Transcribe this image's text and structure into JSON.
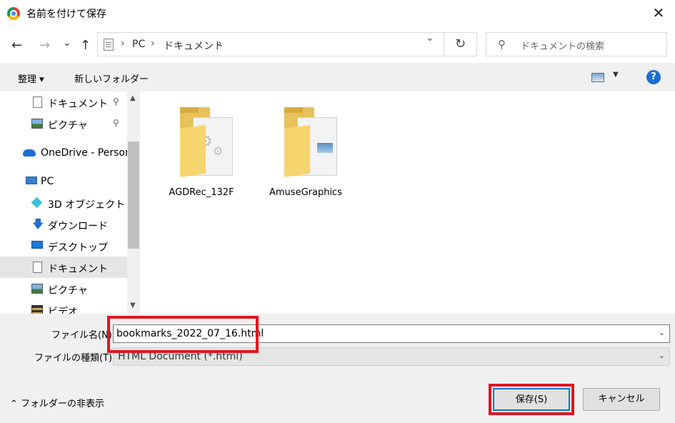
{
  "window": {
    "title": "名前を付けて保存",
    "close_glyph": "✕"
  },
  "nav": {
    "back_glyph": "←",
    "forward_glyph": "→",
    "recent_glyph": "⌄",
    "up_glyph": "↑",
    "refresh_glyph": "↻"
  },
  "address": {
    "crumbs": [
      "PC",
      "ドキュメント"
    ],
    "sep": "›"
  },
  "search": {
    "placeholder": "ドキュメントの検索"
  },
  "toolbar": {
    "organize": "整理 ▾",
    "new_folder": "新しいフォルダー",
    "help": "?"
  },
  "sidebar": {
    "items": [
      {
        "label": "ドキュメント",
        "icon": "document-icon",
        "pinned": true
      },
      {
        "label": "ピクチャ",
        "icon": "pictures-icon",
        "pinned": true
      },
      {
        "label": "OneDrive - Person",
        "icon": "onedrive-icon"
      },
      {
        "label": "PC",
        "icon": "pc-icon"
      },
      {
        "label": "3D オブジェクト",
        "icon": "3d-objects-icon"
      },
      {
        "label": "ダウンロード",
        "icon": "download-icon"
      },
      {
        "label": "デスクトップ",
        "icon": "desktop-icon"
      },
      {
        "label": "ドキュメント",
        "icon": "document-icon",
        "selected": true
      },
      {
        "label": "ピクチャ",
        "icon": "pictures-icon"
      },
      {
        "label": "ビデオ",
        "icon": "video-icon"
      }
    ],
    "pin_glyph": "📌"
  },
  "files": [
    {
      "name": "AGDRec_132F",
      "icon": "folder-icon"
    },
    {
      "name": "AmuseGraphics",
      "icon": "folder-icon"
    }
  ],
  "form": {
    "filename_label": "ファイル名(N):",
    "filename_value": "bookmarks_2022_07_16.html",
    "filetype_label": "ファイルの種類(T):",
    "filetype_value": "HTML Document (*.html)"
  },
  "footer": {
    "hide_folders": "フォルダーの非表示",
    "save": "保存(S)",
    "cancel": "キャンセル"
  },
  "colors": {
    "highlight": "#e01622",
    "accent": "#0078d7"
  }
}
